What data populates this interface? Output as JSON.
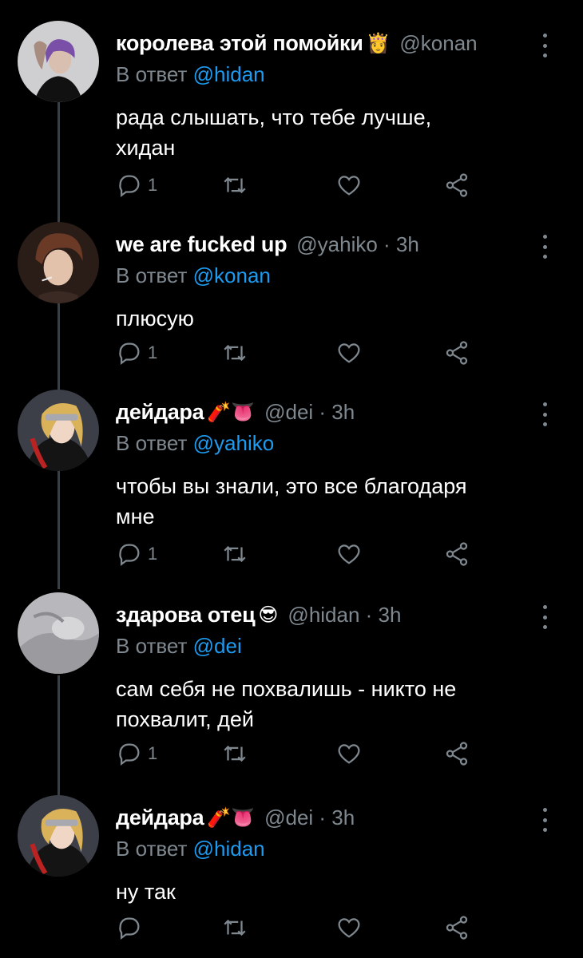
{
  "reply_prefix": "В ответ",
  "tweets": [
    {
      "name": "королева этой помойки",
      "emoji": "👸",
      "handle": "@konan",
      "time": "",
      "reply_to": "@hidan",
      "body_lines": [
        "рада слышать, что тебе лучше,",
        "хидан"
      ],
      "reply_count": "1"
    },
    {
      "name": "we are fucked up",
      "emoji": "",
      "handle": "@yahiko · 3h",
      "time": "",
      "reply_to": "@konan",
      "body_lines": [
        "плюсую"
      ],
      "reply_count": "1"
    },
    {
      "name": "дейдара",
      "emoji": "🧨👅",
      "handle": "@dei · 3h",
      "time": "",
      "reply_to": "@yahiko",
      "body_lines": [
        "чтобы вы знали, это все благодаря",
        "мне"
      ],
      "reply_count": "1"
    },
    {
      "name": "здарова отец",
      "emoji": "😎",
      "handle": "@hidan · 3h",
      "time": "",
      "reply_to": "@dei",
      "body_lines": [
        "сам себя не похвалишь - никто не",
        "похвалит, дей"
      ],
      "reply_count": "1"
    },
    {
      "name": "дейдара",
      "emoji": "🧨👅",
      "handle": "@dei · 3h",
      "time": "",
      "reply_to": "@hidan",
      "body_lines": [
        "ну так"
      ],
      "reply_count": ""
    }
  ],
  "icons": {
    "reply": "reply-icon",
    "retweet": "retweet-icon",
    "like": "heart-icon",
    "share": "share-icon",
    "more": "more-vertical-icon"
  },
  "colors": {
    "background": "#000000",
    "text": "#ffffff",
    "muted": "#7f888f",
    "mention": "#1d9bf0",
    "thread_line": "#3a3f44"
  }
}
